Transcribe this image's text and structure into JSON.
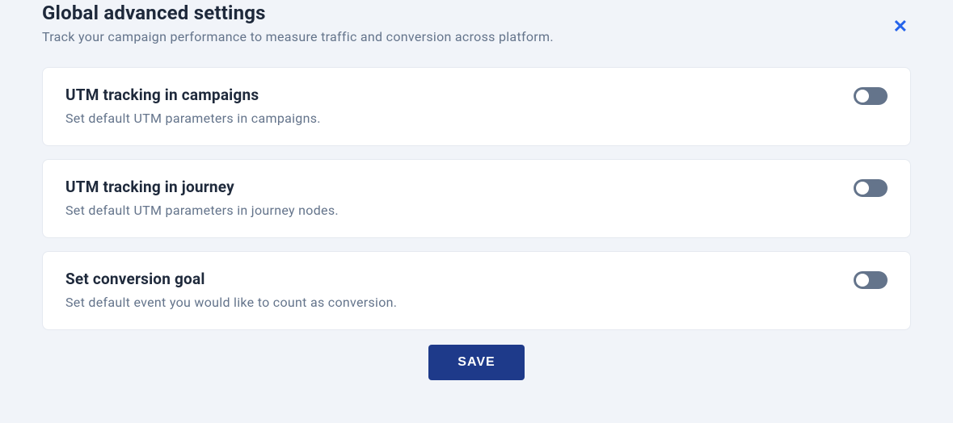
{
  "header": {
    "title": "Global advanced settings",
    "subtitle": "Track your campaign performance to measure traffic and conversion across platform."
  },
  "cards": [
    {
      "title": "UTM tracking in campaigns",
      "description": "Set default UTM parameters in campaigns.",
      "toggle": false
    },
    {
      "title": "UTM tracking in journey",
      "description": "Set default UTM parameters in journey nodes.",
      "toggle": false
    },
    {
      "title": "Set conversion goal",
      "description": "Set default event you would like to count as conversion.",
      "toggle": false
    }
  ],
  "footer": {
    "save_label": "SAVE"
  },
  "close_label": "✕"
}
